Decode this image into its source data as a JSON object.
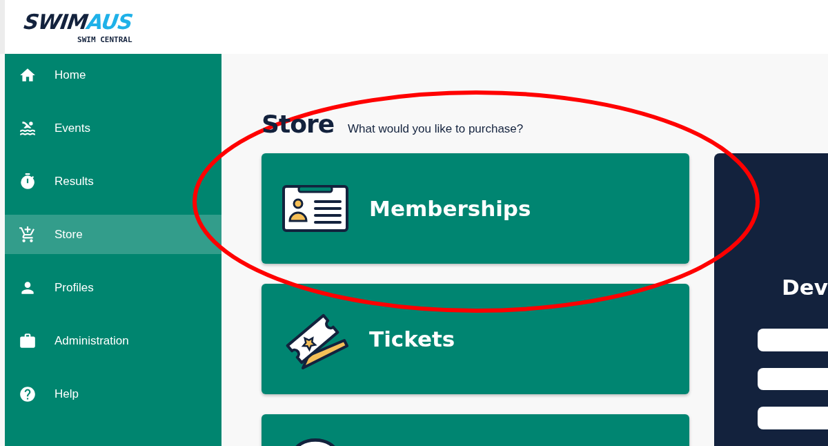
{
  "logo": {
    "primary": "SWIM",
    "accent": "AUS",
    "subtitle": "SWIM CENTRAL"
  },
  "sidebar": {
    "items": [
      {
        "label": "Home",
        "selected": false
      },
      {
        "label": "Events",
        "selected": false
      },
      {
        "label": "Results",
        "selected": false
      },
      {
        "label": "Store",
        "selected": true
      },
      {
        "label": "Profiles",
        "selected": false
      },
      {
        "label": "Administration",
        "selected": false
      },
      {
        "label": "Help",
        "selected": false
      }
    ]
  },
  "page": {
    "title": "Store",
    "subtitle": "What would you like to purchase?"
  },
  "cards": [
    {
      "kind": "full",
      "label": "Memberships"
    },
    {
      "kind": "full",
      "label": "Tickets"
    },
    {
      "kind": "partial"
    }
  ],
  "panel": {
    "heading": "Dev",
    "fields": [
      {
        "kind": "input"
      },
      {
        "kind": "input"
      },
      {
        "kind": "input"
      }
    ]
  },
  "annotation": {
    "kind": "ellipse"
  }
}
